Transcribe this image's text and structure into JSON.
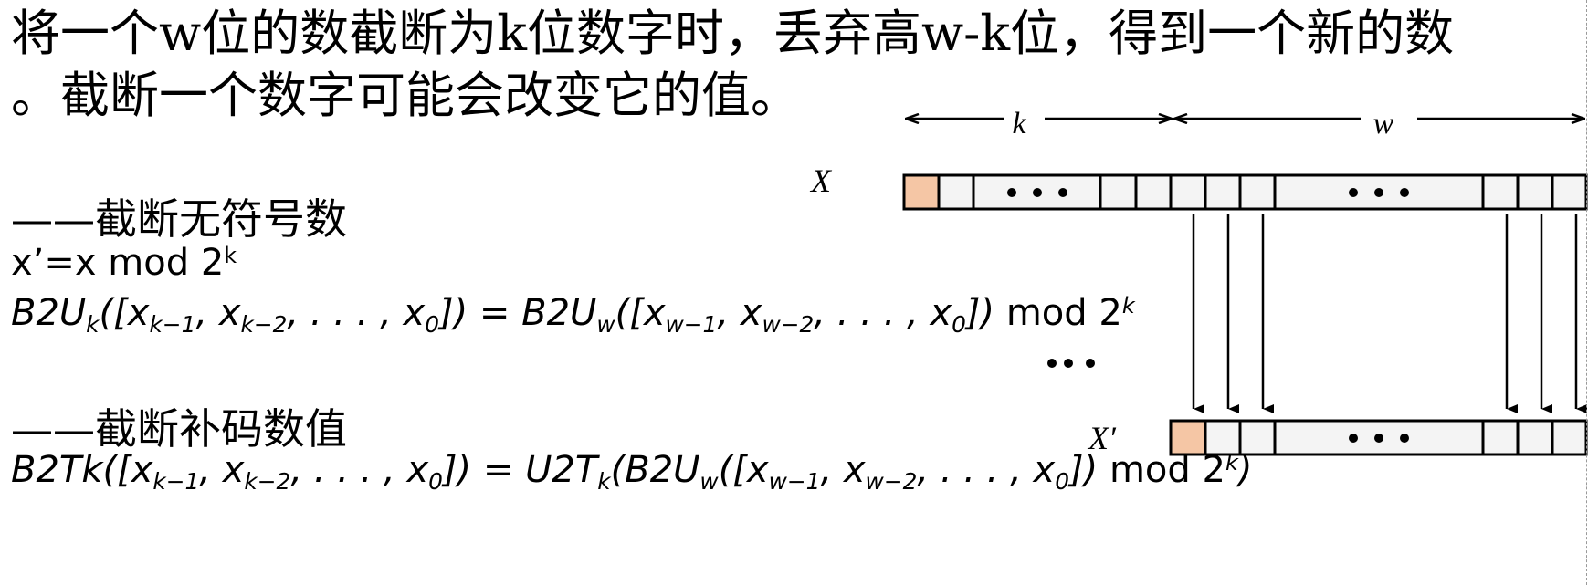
{
  "intro": {
    "line1": "将一个w位的数截断为k位数字时，丢弃高w-k位，得到一个新的数",
    "line2": "。截断一个数字可能会改变它的值。"
  },
  "unsigned": {
    "heading": "——截断无符号数",
    "simple": {
      "lhs": "x’=x mod 2",
      "exp": "k"
    },
    "formula": {
      "p1": "B2U",
      "p1_sub": "k",
      "p2": "([x",
      "s1": "k−1",
      "p3": ", x",
      "s2": "k−2",
      "p4": ", . . . , x",
      "s3": "0",
      "p5": "]) = B2U",
      "s4": "w",
      "p6": "([x",
      "s5": "w−1",
      "p7": ", x",
      "s6": "w−2",
      "p8": ", . . . , x",
      "s7": "0",
      "p9": "]) ",
      "mod": "mod 2",
      "exp": "k"
    }
  },
  "twos": {
    "heading": "——截断补码数值",
    "formula": {
      "p1": "B2Tk([x",
      "s1": "k−1",
      "p2": ", x",
      "s2": "k−2",
      "p3": ", . . . , x",
      "s3": "0",
      "p4": "]) = U2T",
      "s4": "k",
      "p5": "(B2U",
      "s5": "w",
      "p6": "([x",
      "s6": "w−1",
      "p7": ", x",
      "s7": "w−2",
      "p8": ", . . . , x",
      "s8": "0",
      "p9": "]) ",
      "mod": "mod 2",
      "exp": "k",
      "close": ")"
    }
  },
  "diagram": {
    "label_top": "X",
    "label_bottom": "X′",
    "span_k": "k",
    "span_w": "w",
    "colors": {
      "sign_bit": "#f5c6a5",
      "cell": "#f4f4f4",
      "line": "#000000"
    }
  }
}
